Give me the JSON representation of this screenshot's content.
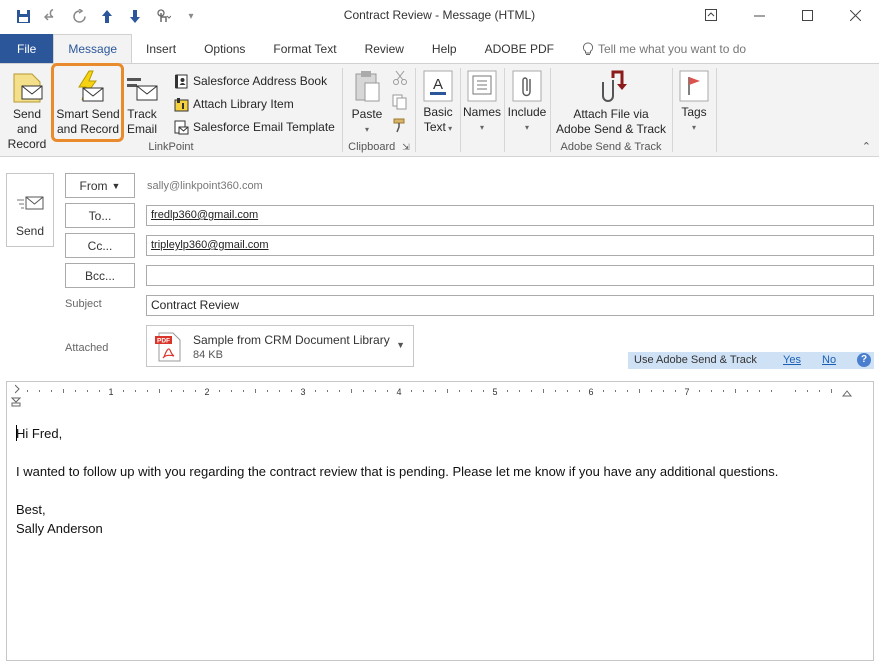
{
  "window": {
    "title": "Contract Review  -  Message (HTML)"
  },
  "tabs": [
    {
      "label": "File"
    },
    {
      "label": "Message"
    },
    {
      "label": "Insert"
    },
    {
      "label": "Options"
    },
    {
      "label": "Format Text"
    },
    {
      "label": "Review"
    },
    {
      "label": "Help"
    },
    {
      "label": "ADOBE PDF"
    }
  ],
  "tell_me": "Tell me what you want to do",
  "ribbon": {
    "linkpoint": {
      "label": "LinkPoint",
      "send_record": [
        "Send and",
        "Record"
      ],
      "smart_send": [
        "Smart Send",
        "and Record"
      ],
      "track_email": [
        "Track",
        "Email"
      ],
      "address_book": "Salesforce Address Book",
      "attach_library": "Attach Library Item",
      "email_template": "Salesforce Email Template"
    },
    "clipboard": {
      "label": "Clipboard",
      "paste": "Paste"
    },
    "basic_text": [
      "Basic",
      "Text"
    ],
    "names": "Names",
    "include": "Include",
    "adobe": {
      "label": "Adobe Send & Track",
      "attach": [
        "Attach File via",
        "Adobe Send & Track"
      ]
    },
    "tags": "Tags",
    "accent": "#e98a2c"
  },
  "header": {
    "send": "Send",
    "from_btn": "From",
    "from_value": "sally@linkpoint360.com",
    "to_btn": "To...",
    "to_value": "fredlp360@gmail.com",
    "cc_btn": "Cc...",
    "cc_value": "tripleylp360@gmail.com",
    "bcc_btn": "Bcc...",
    "bcc_value": "",
    "subject_label": "Subject",
    "subject_value": "Contract Review",
    "attached_label": "Attached",
    "attachment_name": "Sample from CRM Document Library",
    "attachment_size": "84 KB"
  },
  "adobe_bar": {
    "text": "Use Adobe Send & Track",
    "yes": "Yes",
    "no": "No",
    "help": "?"
  },
  "ruler": [
    "1",
    "2",
    "3",
    "4",
    "5",
    "6",
    "7"
  ],
  "body": {
    "greeting": "Hi Fred,",
    "paragraph": "I wanted to follow up with you regarding the contract review that is pending. Please let me know if you have any additional questions.",
    "closing": "Best,",
    "signature": "Sally Anderson"
  }
}
